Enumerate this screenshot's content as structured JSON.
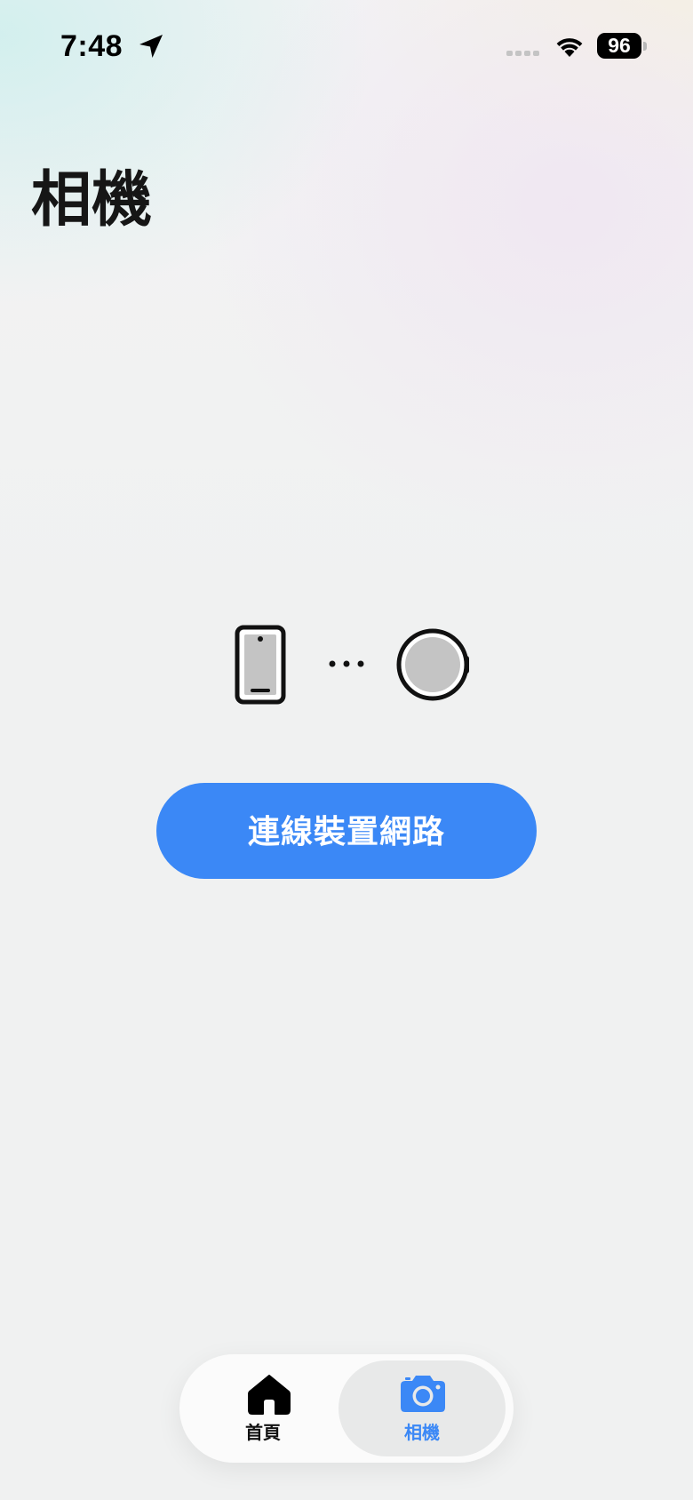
{
  "status_bar": {
    "time": "7:48",
    "battery_level": "96",
    "icons": [
      "location-arrow-icon",
      "cellular-signal-icon",
      "wifi-icon",
      "battery-icon"
    ]
  },
  "page": {
    "title": "相機"
  },
  "connection_graphic": {
    "icons": [
      "phone-icon",
      "ellipsis-icon",
      "camera-device-icon"
    ]
  },
  "primary_action": {
    "label": "連線裝置網路"
  },
  "tab_bar": {
    "tabs": [
      {
        "label": "首頁",
        "icon": "home-icon",
        "selected": false
      },
      {
        "label": "相機",
        "icon": "camera-icon",
        "selected": true
      }
    ]
  },
  "colors": {
    "accent": "#3b88f6",
    "title_text": "#161616",
    "background": "#f0f1f1",
    "selected_tab_bg": "#e8e9e9"
  }
}
